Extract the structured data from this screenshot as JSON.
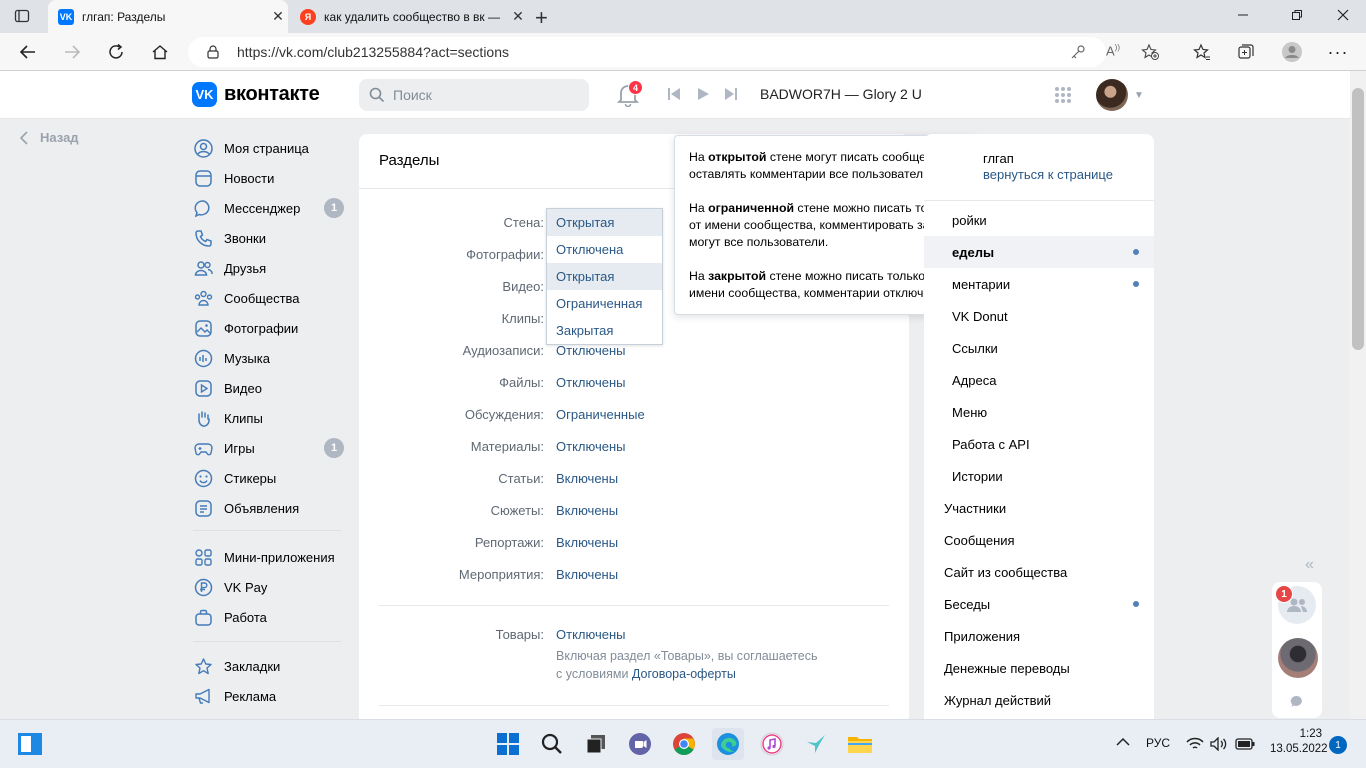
{
  "browser": {
    "tabs": [
      {
        "title": "глгап: Разделы",
        "active": true,
        "favicon": "vk-favicon"
      },
      {
        "title": "как удалить сообщество в вк —",
        "active": false,
        "favicon": "yandex-favicon"
      }
    ],
    "url": "https://vk.com/club213255884?act=sections"
  },
  "header": {
    "logo_text": "вконтакте",
    "logo_mark": "VK",
    "search_placeholder": "Поиск",
    "notifications_count": "4",
    "now_playing": "BADWOR7H — Glory 2 U"
  },
  "back_label": "Назад",
  "left_menu": [
    {
      "label": "Моя страница",
      "icon": "user-icon"
    },
    {
      "label": "Новости",
      "icon": "news-icon"
    },
    {
      "label": "Мессенджер",
      "icon": "message-icon",
      "badge": "1"
    },
    {
      "label": "Звонки",
      "icon": "phone-icon"
    },
    {
      "label": "Друзья",
      "icon": "friends-icon"
    },
    {
      "label": "Сообщества",
      "icon": "groups-icon"
    },
    {
      "label": "Фотографии",
      "icon": "photo-icon"
    },
    {
      "label": "Музыка",
      "icon": "music-icon"
    },
    {
      "label": "Видео",
      "icon": "video-icon"
    },
    {
      "label": "Клипы",
      "icon": "clips-icon"
    },
    {
      "label": "Игры",
      "icon": "games-icon",
      "badge": "1"
    },
    {
      "label": "Стикеры",
      "icon": "smile-icon"
    },
    {
      "label": "Объявления",
      "icon": "ads-icon"
    },
    {
      "label": "Мини-приложения",
      "icon": "apps-icon"
    },
    {
      "label": "VK Pay",
      "icon": "vkpay-icon"
    },
    {
      "label": "Работа",
      "icon": "briefcase-icon"
    },
    {
      "label": "Закладки",
      "icon": "star-icon"
    },
    {
      "label": "Реклама",
      "icon": "megaphone-icon"
    }
  ],
  "main": {
    "title": "Разделы",
    "sections": [
      {
        "label": "Стена:",
        "value": "Открытая"
      },
      {
        "label": "Фотографии:",
        "value": ""
      },
      {
        "label": "Видео:",
        "value": ""
      },
      {
        "label": "Клипы:",
        "value": ""
      },
      {
        "label": "Аудиозаписи:",
        "value": "Отключены"
      },
      {
        "label": "Файлы:",
        "value": "Отключены"
      },
      {
        "label": "Обсуждения:",
        "value": "Ограниченные"
      },
      {
        "label": "Материалы:",
        "value": "Отключены"
      },
      {
        "label": "Статьи:",
        "value": "Включены"
      },
      {
        "label": "Сюжеты:",
        "value": "Включены"
      },
      {
        "label": "Репортажи:",
        "value": "Включены"
      },
      {
        "label": "Мероприятия:",
        "value": "Включены"
      }
    ],
    "goods": {
      "label": "Товары:",
      "value": "Отключены",
      "note_line1": "Включая раздел «Товары», вы соглашаетесь",
      "note_prefix": "с условиями ",
      "note_link": "Договора-оферты"
    }
  },
  "dropdown": {
    "options": [
      "Открытая",
      "Отключена",
      "Открытая",
      "Ограниченная",
      "Закрытая"
    ],
    "highlighted": [
      0,
      2
    ]
  },
  "tooltip": {
    "p1_pre": "На ",
    "p1_bold": "открытой",
    "p1_post": " стене могут писать сообщения и оставлять комментарии все пользователи.",
    "p2_pre": "На ",
    "p2_bold": "ограниченной",
    "p2_post": " стене можно писать только от имени сообщества, комментировать записи могут все пользователи.",
    "p3_pre": "На ",
    "p3_bold": "закрытой",
    "p3_post": " стене можно писать только от имени сообщества, комментарии отключены."
  },
  "right_menu": {
    "group_name": "глгап",
    "return_link": "вернуться к странице",
    "items": [
      {
        "label": "ройки",
        "indent": true
      },
      {
        "label": "еделы",
        "indent": true,
        "active": true,
        "dot": true
      },
      {
        "label": "ментарии",
        "indent": true,
        "dot": true
      },
      {
        "label": "VK Donut",
        "indent": true
      },
      {
        "label": "Ссылки",
        "indent": true
      },
      {
        "label": "Адреса",
        "indent": true
      },
      {
        "label": "Меню",
        "indent": true
      },
      {
        "label": "Работа с API",
        "indent": true
      },
      {
        "label": "Истории",
        "indent": true
      },
      {
        "label": "Участники",
        "indent": false
      },
      {
        "label": "Сообщения",
        "indent": false
      },
      {
        "label": "Сайт из сообщества",
        "indent": false
      },
      {
        "label": "Беседы",
        "indent": false,
        "dot": true
      },
      {
        "label": "Приложения",
        "indent": false
      },
      {
        "label": "Денежные переводы",
        "indent": false
      },
      {
        "label": "Журнал действий",
        "indent": false
      }
    ]
  },
  "floating": {
    "badge": "1"
  },
  "taskbar": {
    "lang": "РУС",
    "time": "1:23",
    "date": "13.05.2022",
    "notifications": "1"
  },
  "colors": {
    "vk_blue": "#0077ff",
    "link": "#2a5885",
    "accent_dot": "#5181b8",
    "badge_red": "#ff3347"
  }
}
